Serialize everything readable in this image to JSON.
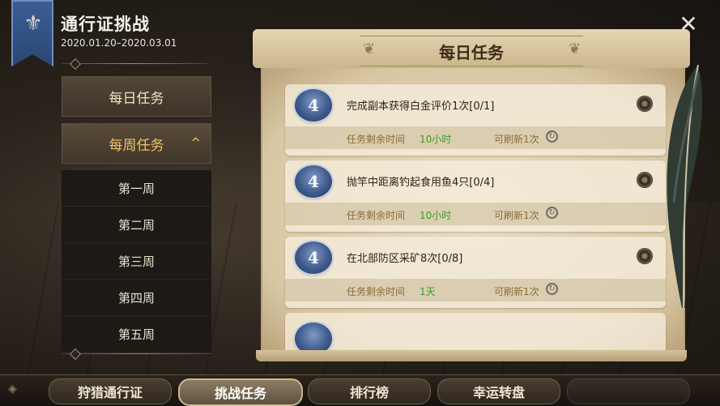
{
  "header": {
    "title": "通行证挑战",
    "dates": "2020.01.20–2020.03.01"
  },
  "menu": {
    "daily": "每日任务",
    "weekly": "每周任务",
    "weeks": [
      "第一周",
      "第二周",
      "第三周",
      "第四周",
      "第五周"
    ]
  },
  "panel": {
    "title": "每日任务"
  },
  "tasks": [
    {
      "level": "4",
      "name": "完成副本获得白金评价1次[0/1]",
      "time_label": "任务剩余时间",
      "time_value": "10小时",
      "refresh": "可刷新1次"
    },
    {
      "level": "4",
      "name": "抛竿中距离钓起食用鱼4只[0/4]",
      "time_label": "任务剩余时间",
      "time_value": "10小时",
      "refresh": "可刷新1次"
    },
    {
      "level": "4",
      "name": "在北部防区采矿8次[0/8]",
      "time_label": "任务剩余时间",
      "time_value": "1天",
      "refresh": "可刷新1次"
    }
  ],
  "tabs": [
    "狩猎通行证",
    "挑战任务",
    "排行榜",
    "幸运转盘"
  ],
  "icons": {
    "close": "close-icon",
    "refresh": "refresh-icon",
    "goto": "goto-icon",
    "banner": "banner-emblem-icon"
  },
  "colors": {
    "accent_gold": "#f0c46a",
    "time_green": "#3f9a2a",
    "badge_blue": "#3f5b8c"
  }
}
